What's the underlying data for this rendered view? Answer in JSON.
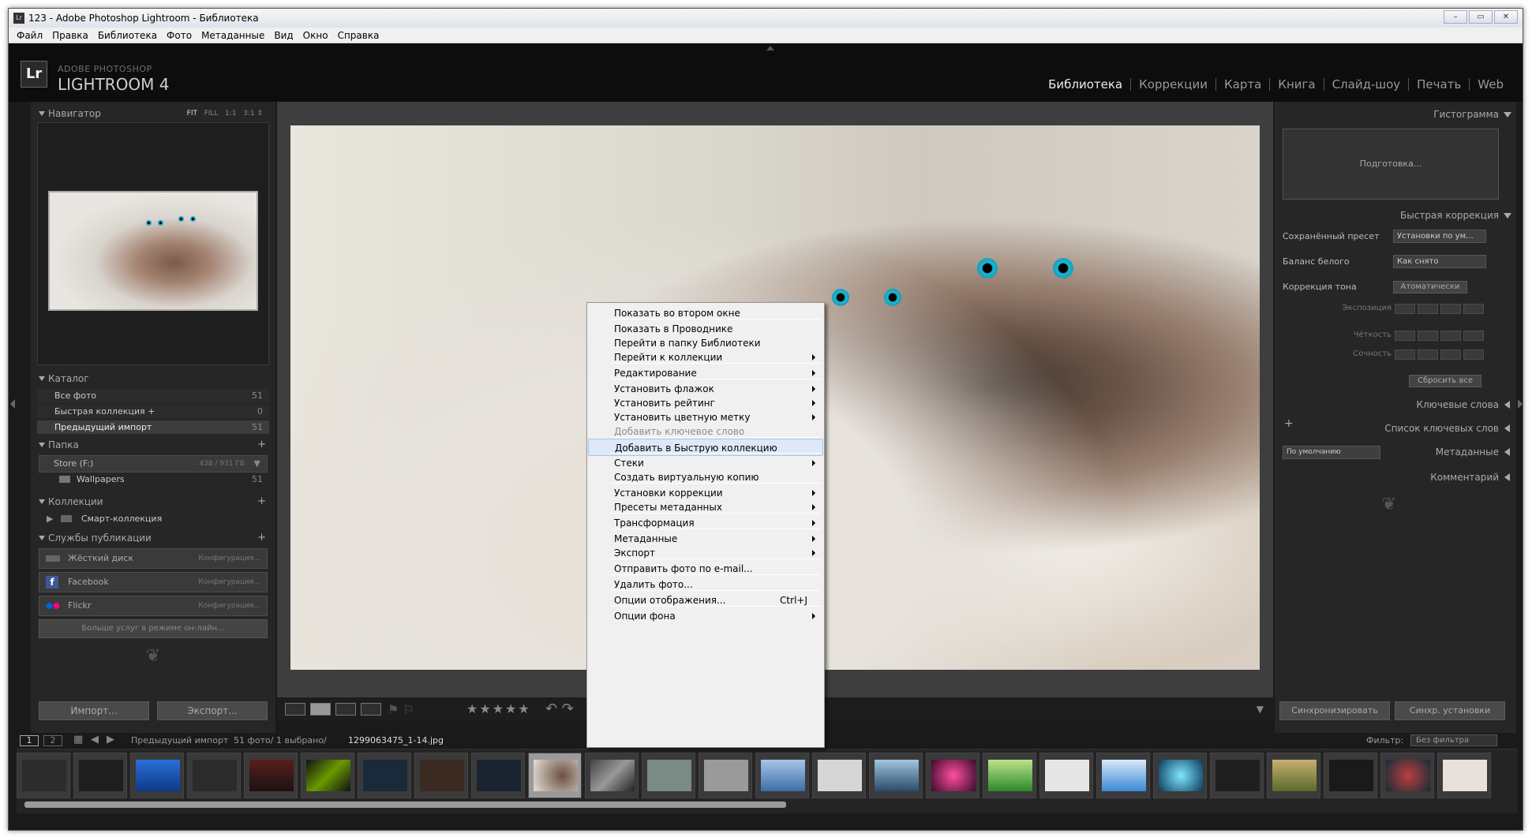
{
  "window": {
    "title": "123 - Adobe Photoshop Lightroom - Библиотека",
    "menus": [
      "Файл",
      "Правка",
      "Библиотека",
      "Фото",
      "Метаданные",
      "Вид",
      "Окно",
      "Справка"
    ]
  },
  "header": {
    "product_line1": "ADOBE PHOTOSHOP",
    "product_line2": "LIGHTROOM 4",
    "logo": "Lr",
    "modules": [
      "Библиотека",
      "Коррекции",
      "Карта",
      "Книга",
      "Слайд-шоу",
      "Печать",
      "Web"
    ],
    "active_module": "Библиотека"
  },
  "left": {
    "navigator": {
      "title": "Навигатор",
      "opts": [
        "FIT",
        "FILL",
        "1:1",
        "3:1"
      ]
    },
    "catalog": {
      "title": "Каталог",
      "rows": [
        {
          "label": "Все фото",
          "count": "51"
        },
        {
          "label": "Быстрая коллекция +",
          "count": "0"
        },
        {
          "label": "Предыдущий импорт",
          "count": "51"
        }
      ]
    },
    "folders": {
      "title": "Папка",
      "drive": "Store (F:)",
      "drive_size": "438 / 931 ГБ",
      "folder": "Wallpapers",
      "folder_count": "51"
    },
    "collections": {
      "title": "Коллекции",
      "item": "Смарт-коллекция"
    },
    "publish": {
      "title": "Службы публикации",
      "rows": [
        {
          "label": "Жёсткий диск",
          "cfg": "Конфигурация..."
        },
        {
          "label": "Facebook",
          "cfg": "Конфигурация..."
        },
        {
          "label": "Flickr",
          "cfg": "Конфигурация..."
        }
      ],
      "more": "Больше услуг в режиме он-лайн..."
    },
    "import_btn": "Импорт...",
    "export_btn": "Экспорт..."
  },
  "right": {
    "histogram": "Гистограмма",
    "histo_status": "Подготовка...",
    "quick_dev": "Быстрая коррекция",
    "saved_preset_label": "Сохранённый пресет",
    "saved_preset_value": "Установки по ум...",
    "wb_label": "Баланс белого",
    "wb_value": "Как снято",
    "tone_label": "Коррекция тона",
    "tone_btn": "Атоматически",
    "exposure": "Экспозиция",
    "clarity": "Чёткость",
    "vibrance": "Сочность",
    "reset": "Сбросить все",
    "keywords": "Ключевые слова",
    "keyword_list": "Список ключевых слов",
    "metadata_preset": "По умолчанию",
    "metadata": "Метаданные",
    "comments": "Комментарий",
    "sync": "Синхронизировать",
    "sync_settings": "Синхр. установки"
  },
  "filmbar": {
    "pages": [
      "1",
      "2"
    ],
    "source": "Предыдущий импорт",
    "counts": "51 фото/ 1 выбрано/",
    "filename": "1299063475_1-14.jpg",
    "filter_label": "Фильтр:",
    "filter_value": "Без фильтра"
  },
  "context_menu": [
    {
      "label": "Показать во втором окне"
    },
    {
      "sep": true
    },
    {
      "label": "Показать в Проводнике"
    },
    {
      "label": "Перейти в папку Библиотеки"
    },
    {
      "label": "Перейти к коллекции",
      "sub": true
    },
    {
      "sep": true
    },
    {
      "label": "Редактирование",
      "sub": true
    },
    {
      "sep": true
    },
    {
      "label": "Установить флажок",
      "sub": true
    },
    {
      "label": "Установить рейтинг",
      "sub": true
    },
    {
      "label": "Установить цветную метку",
      "sub": true
    },
    {
      "label": "Добавить ключевое слово",
      "disabled": true
    },
    {
      "sep": true
    },
    {
      "label": "Добавить в Быструю коллекцию",
      "highlight": true
    },
    {
      "sep": true
    },
    {
      "label": "Стеки",
      "sub": true
    },
    {
      "label": "Создать виртуальную копию"
    },
    {
      "sep": true
    },
    {
      "label": "Установки коррекции",
      "sub": true
    },
    {
      "label": "Пресеты метаданных",
      "sub": true
    },
    {
      "sep": true
    },
    {
      "label": "Трансформация",
      "sub": true
    },
    {
      "sep": true
    },
    {
      "label": "Метаданные",
      "sub": true
    },
    {
      "label": "Экспорт",
      "sub": true
    },
    {
      "sep": true
    },
    {
      "label": "Отправить фото по e-mail..."
    },
    {
      "sep": true
    },
    {
      "label": "Удалить фото..."
    },
    {
      "sep": true
    },
    {
      "label": "Опции отображения...",
      "shortcut": "Ctrl+J"
    },
    {
      "sep": true
    },
    {
      "label": "Опции фона",
      "sub": true
    }
  ],
  "colors": {
    "accent": "#dde9f6",
    "panel": "#262626",
    "bg": "#1a1a1a"
  }
}
